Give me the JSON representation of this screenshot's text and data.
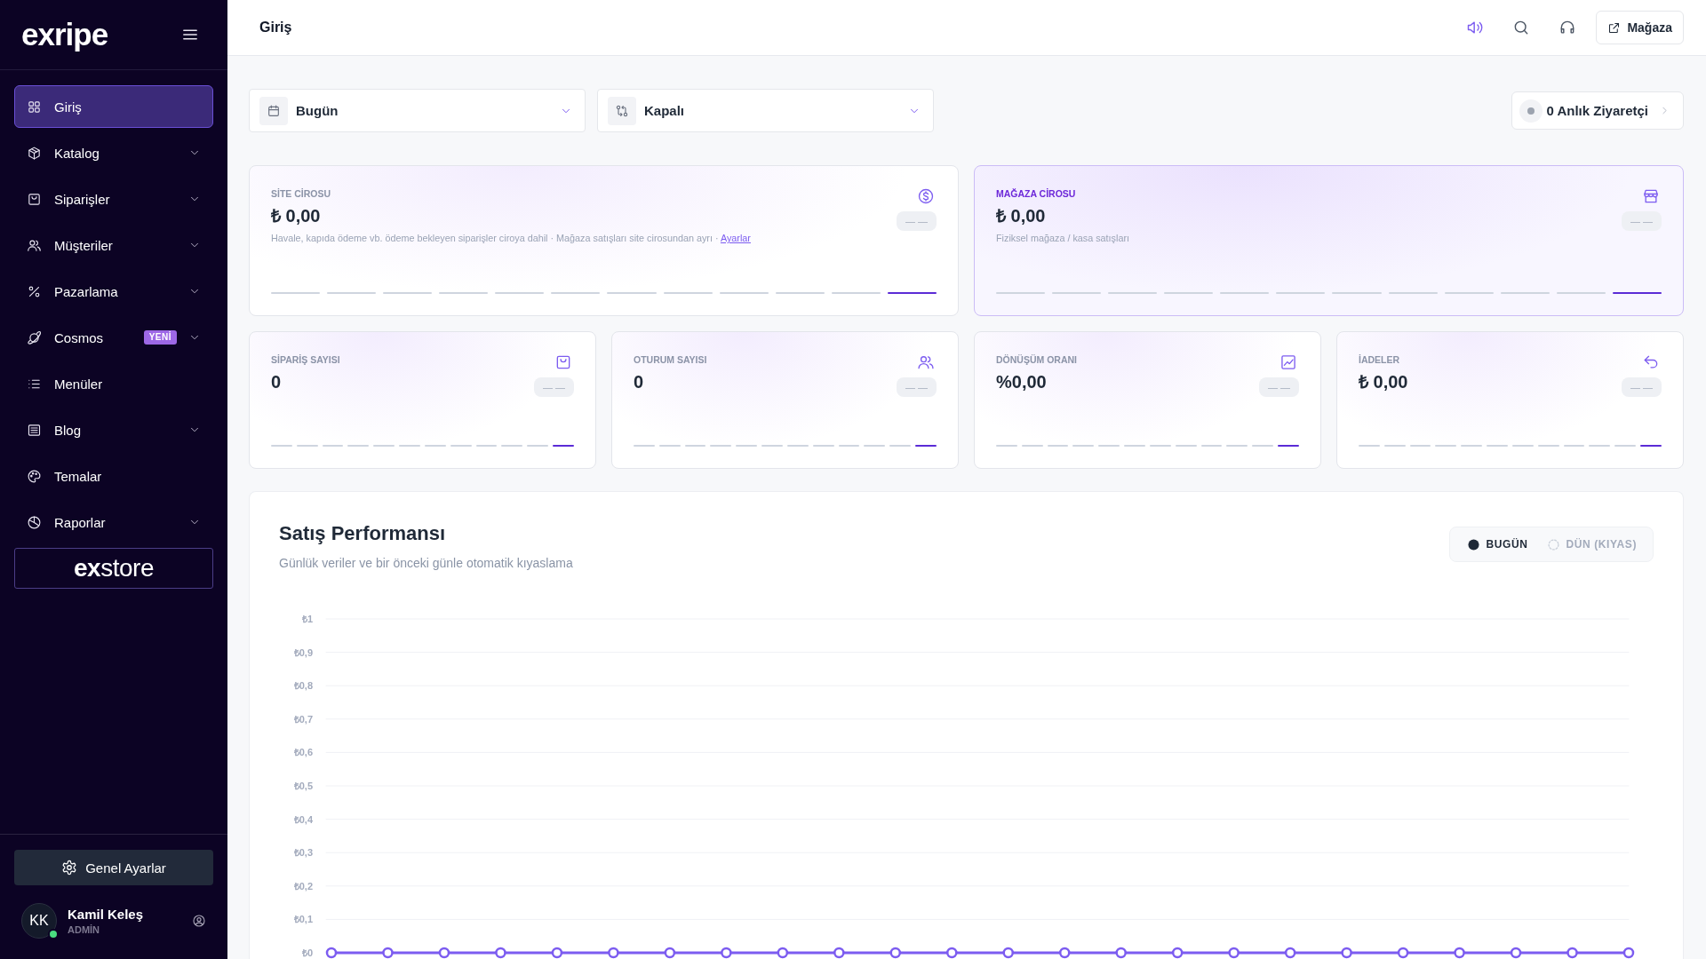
{
  "sidebar": {
    "logo": "exripe",
    "nav_items": [
      {
        "label": "Giriş",
        "selected": true,
        "expandable": false
      },
      {
        "label": "Katalog",
        "selected": false,
        "expandable": true
      },
      {
        "label": "Siparişler",
        "selected": false,
        "expandable": true
      },
      {
        "label": "Müşteriler",
        "selected": false,
        "expandable": true
      },
      {
        "label": "Pazarlama",
        "selected": false,
        "expandable": true
      },
      {
        "label": "Cosmos",
        "selected": false,
        "expandable": true,
        "badge": "YENİ"
      },
      {
        "label": "Menüler",
        "selected": false,
        "expandable": false
      },
      {
        "label": "Blog",
        "selected": false,
        "expandable": true
      },
      {
        "label": "Temalar",
        "selected": false,
        "expandable": false
      },
      {
        "label": "Raporlar",
        "selected": false,
        "expandable": true
      }
    ],
    "store_logo": "**ex**store",
    "settings_button": "Genel Ayarlar",
    "user": {
      "initials": "KK",
      "name": "Kamil Keleş",
      "role": "ADMİN",
      "online": true
    }
  },
  "header": {
    "title": "Giriş",
    "store_button": "Mağaza"
  },
  "filters": {
    "date_range": "Bugün",
    "comparison": "Kapalı",
    "live_visitors": {
      "label": "0 Anlık Ziyaretçi",
      "live": false
    }
  },
  "revenue_cards": [
    {
      "label": "SİTE CİROSU",
      "value": "₺ 0,00",
      "change": "— —",
      "note": "Havale, kapıda ödeme vb. ödeme bekleyen siparişler ciroya dahil · Mağaza satışları site cirosundan ayrı ·",
      "link": "Ayarlar",
      "highlighted": false
    },
    {
      "label": "MAĞAZA CİROSU",
      "value": "₺ 0,00",
      "change": "— —",
      "note": "Fiziksel mağaza / kasa satışları",
      "highlighted": true
    }
  ],
  "stat_cards": [
    {
      "label": "SİPARİŞ SAYISI",
      "value": "0",
      "change": "— —",
      "highlighted": false
    },
    {
      "label": "OTURUM SAYISI",
      "value": "0",
      "change": "— —",
      "highlighted": false
    },
    {
      "label": "DÖNÜŞÜM ORANI",
      "value": "%0,00",
      "change": "— —",
      "highlighted": false
    },
    {
      "label": "İADELER",
      "value": "₺ 0,00",
      "change": "— —",
      "highlighted": false
    }
  ],
  "sales_chart": {
    "title": "Satış Performansı",
    "subtitle": "Günlük veriler ve bir önceki günle otomatik kıyaslama",
    "legend": [
      {
        "label": "BUGÜN",
        "active": true
      },
      {
        "label": "DÜN (KIYAS)",
        "active": false
      }
    ],
    "chart_data": {
      "type": "line",
      "grid": true,
      "ylim": [
        0,
        1
      ],
      "yticks": [
        {
          "value": 0,
          "label": "₺0"
        },
        {
          "value": 0.1,
          "label": "₺0,1"
        },
        {
          "value": 0.2,
          "label": "₺0,2"
        },
        {
          "value": 0.3,
          "label": "₺0,3"
        },
        {
          "value": 0.4,
          "label": "₺0,4"
        },
        {
          "value": 0.5,
          "label": "₺0,5"
        },
        {
          "value": 0.6,
          "label": "₺0,6"
        },
        {
          "value": 0.7,
          "label": "₺0,7"
        },
        {
          "value": 0.8,
          "label": "₺0,8"
        },
        {
          "value": 0.9,
          "label": "₺0,9"
        },
        {
          "value": 1,
          "label": "₺1"
        }
      ],
      "series": [
        {
          "color": "#7c5cf0",
          "marker": "circle",
          "values": [
            0,
            0,
            0,
            0,
            0,
            0,
            0,
            0,
            0,
            0,
            0,
            0,
            0,
            0,
            0,
            0,
            0,
            0,
            0,
            0,
            0,
            0,
            0,
            0
          ]
        }
      ]
    }
  }
}
